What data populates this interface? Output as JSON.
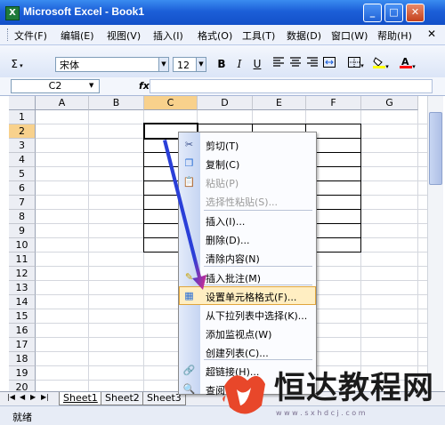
{
  "window": {
    "title": "Microsoft Excel - Book1",
    "app_icon_glyph": "X",
    "min": "_",
    "max": "□",
    "close": "✕"
  },
  "menu": {
    "items": [
      "文件(F)",
      "编辑(E)",
      "视图(V)",
      "插入(I)",
      "格式(O)",
      "工具(T)",
      "数据(D)",
      "窗口(W)",
      "帮助(H)"
    ],
    "doc_close": "✕"
  },
  "toolbar": {
    "autosum": "Σ",
    "font_name": "宋体",
    "font_size": "12",
    "bold": "B",
    "italic": "I",
    "underline": "U",
    "fill_color": "#ffff00",
    "font_color": "#ff0000"
  },
  "formula_bar": {
    "namebox": "C2",
    "fx": "fx",
    "value": ""
  },
  "grid": {
    "columns": [
      "A",
      "B",
      "C",
      "D",
      "E",
      "F",
      "G"
    ],
    "rows": [
      "1",
      "2",
      "3",
      "4",
      "5",
      "6",
      "7",
      "8",
      "9",
      "10",
      "11",
      "12",
      "13",
      "14",
      "15",
      "16",
      "17",
      "18",
      "19",
      "20"
    ],
    "selected_column": "C",
    "selected_row": "2"
  },
  "sheet_tabs": [
    "Sheet1",
    "Sheet2",
    "Sheet3"
  ],
  "status": {
    "text": "就绪"
  },
  "context_menu": {
    "items": [
      {
        "label": "剪切(T)",
        "icon": "scissors-icon",
        "enabled": true
      },
      {
        "label": "复制(C)",
        "icon": "copy-icon",
        "enabled": true
      },
      {
        "label": "粘贴(P)",
        "icon": "paste-icon",
        "enabled": false
      },
      {
        "label": "选择性粘贴(S)...",
        "icon": "",
        "enabled": false
      },
      {
        "label": "插入(I)...",
        "icon": "",
        "enabled": true
      },
      {
        "label": "删除(D)...",
        "icon": "",
        "enabled": true
      },
      {
        "label": "清除内容(N)",
        "icon": "",
        "enabled": true
      },
      {
        "label": "插入批注(M)",
        "icon": "comment-icon",
        "enabled": true
      },
      {
        "label": "设置单元格格式(F)...",
        "icon": "format-cells-icon",
        "enabled": true,
        "highlighted": true
      },
      {
        "label": "从下拉列表中选择(K)...",
        "icon": "",
        "enabled": true
      },
      {
        "label": "添加监视点(W)",
        "icon": "",
        "enabled": true
      },
      {
        "label": "创建列表(C)...",
        "icon": "",
        "enabled": true
      },
      {
        "label": "超链接(H)...",
        "icon": "hyperlink-icon",
        "enabled": true
      },
      {
        "label": "查阅",
        "icon": "research-icon",
        "enabled": true
      }
    ]
  },
  "annotation": {
    "arrow_color": "#2a3fd8",
    "target_color": "#e02a8a"
  },
  "watermark": {
    "brand": "恒达教程网",
    "url": "w w w . s x h d c j . c o m",
    "color": "#e8472a"
  }
}
